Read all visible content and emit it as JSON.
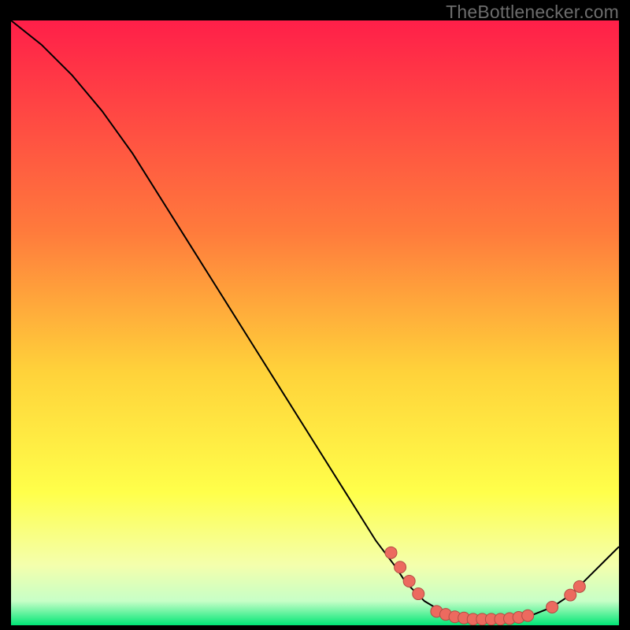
{
  "watermark": "TheBottlenecker.com",
  "colors": {
    "black": "#000000",
    "curve": "#000000",
    "dot_fill": "#ec6a5f",
    "dot_stroke": "#b34c44",
    "grad_top": "#ff1f49",
    "grad_mid1": "#ff7b3c",
    "grad_mid2": "#ffd23a",
    "grad_mid3": "#ffff4a",
    "grad_mid4": "#f4ffac",
    "grad_mid5": "#c7ffc7",
    "grad_bottom": "#00e676"
  },
  "chart_data": {
    "type": "line",
    "title": "",
    "xlabel": "",
    "ylabel": "",
    "xlim": [
      0,
      100
    ],
    "ylim": [
      0,
      100
    ],
    "curve": [
      {
        "x": 0,
        "y": 100
      },
      {
        "x": 5,
        "y": 96
      },
      {
        "x": 10,
        "y": 91
      },
      {
        "x": 15,
        "y": 85
      },
      {
        "x": 20,
        "y": 78
      },
      {
        "x": 25,
        "y": 70
      },
      {
        "x": 30,
        "y": 62
      },
      {
        "x": 35,
        "y": 54
      },
      {
        "x": 40,
        "y": 46
      },
      {
        "x": 45,
        "y": 38
      },
      {
        "x": 50,
        "y": 30
      },
      {
        "x": 55,
        "y": 22
      },
      {
        "x": 60,
        "y": 14
      },
      {
        "x": 63,
        "y": 10
      },
      {
        "x": 65,
        "y": 7
      },
      {
        "x": 68,
        "y": 4
      },
      {
        "x": 71,
        "y": 2.2
      },
      {
        "x": 74,
        "y": 1.3
      },
      {
        "x": 77,
        "y": 1.0
      },
      {
        "x": 80,
        "y": 1.0
      },
      {
        "x": 83,
        "y": 1.2
      },
      {
        "x": 86,
        "y": 1.8
      },
      {
        "x": 89,
        "y": 3.0
      },
      {
        "x": 92,
        "y": 5.0
      },
      {
        "x": 95,
        "y": 8.0
      },
      {
        "x": 98,
        "y": 11.0
      },
      {
        "x": 100,
        "y": 13.0
      }
    ],
    "dots": [
      {
        "x": 62.5,
        "y": 12.0
      },
      {
        "x": 64.0,
        "y": 9.6
      },
      {
        "x": 65.5,
        "y": 7.3
      },
      {
        "x": 67.0,
        "y": 5.2
      },
      {
        "x": 70.0,
        "y": 2.3
      },
      {
        "x": 71.5,
        "y": 1.8
      },
      {
        "x": 73.0,
        "y": 1.4
      },
      {
        "x": 74.5,
        "y": 1.2
      },
      {
        "x": 76.0,
        "y": 1.0
      },
      {
        "x": 77.5,
        "y": 1.0
      },
      {
        "x": 79.0,
        "y": 1.0
      },
      {
        "x": 80.5,
        "y": 1.0
      },
      {
        "x": 82.0,
        "y": 1.1
      },
      {
        "x": 83.5,
        "y": 1.3
      },
      {
        "x": 85.0,
        "y": 1.6
      },
      {
        "x": 89.0,
        "y": 3.0
      },
      {
        "x": 92.0,
        "y": 5.0
      },
      {
        "x": 93.5,
        "y": 6.4
      }
    ]
  }
}
